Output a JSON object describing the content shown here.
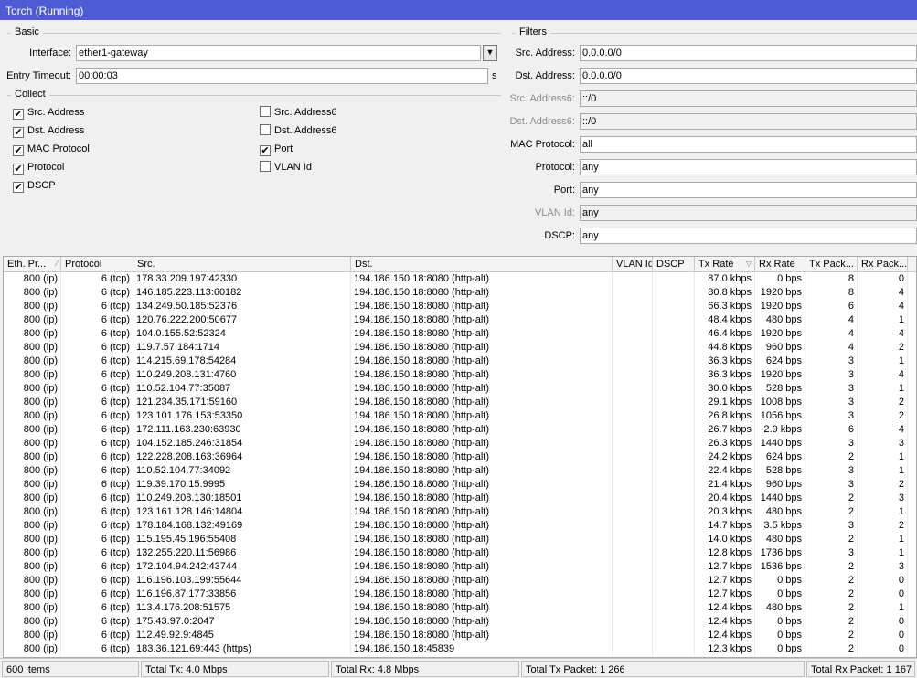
{
  "window": {
    "title": "Torch (Running)"
  },
  "basic": {
    "title": "Basic",
    "interface_label": "Interface:",
    "interface_value": "ether1-gateway",
    "timeout_label": "Entry Timeout:",
    "timeout_value": "00:00:03",
    "timeout_unit": "s"
  },
  "collect": {
    "title": "Collect",
    "items": [
      {
        "label": "Src. Address",
        "checked": true
      },
      {
        "label": "Dst. Address",
        "checked": true
      },
      {
        "label": "MAC Protocol",
        "checked": true
      },
      {
        "label": "Protocol",
        "checked": true
      },
      {
        "label": "DSCP",
        "checked": true
      },
      {
        "label": "Src. Address6",
        "checked": false
      },
      {
        "label": "Dst. Address6",
        "checked": false
      },
      {
        "label": "Port",
        "checked": true
      },
      {
        "label": "VLAN Id",
        "checked": false
      }
    ]
  },
  "filters": {
    "title": "Filters",
    "items": [
      {
        "label": "Src. Address:",
        "value": "0.0.0.0/0",
        "disabled": false
      },
      {
        "label": "Dst. Address:",
        "value": "0.0.0.0/0",
        "disabled": false
      },
      {
        "label": "Src. Address6:",
        "value": "::/0",
        "disabled": true
      },
      {
        "label": "Dst. Address6:",
        "value": "::/0",
        "disabled": true
      },
      {
        "label": "MAC Protocol:",
        "value": "all",
        "disabled": false
      },
      {
        "label": "Protocol:",
        "value": "any",
        "disabled": false
      },
      {
        "label": "Port:",
        "value": "any",
        "disabled": false
      },
      {
        "label": "VLAN Id:",
        "value": "any",
        "disabled": true
      },
      {
        "label": "DSCP:",
        "value": "any",
        "disabled": false
      }
    ]
  },
  "table": {
    "columns": [
      "Eth. Pr...",
      "Protocol",
      "Src.",
      "Dst.",
      "VLAN Id",
      "DSCP",
      "Tx Rate",
      "Rx Rate",
      "Tx Pack...",
      "Rx Pack..."
    ],
    "rows": [
      [
        "800 (ip)",
        "6 (tcp)",
        "178.33.209.197:42330",
        "194.186.150.18:8080 (http-alt)",
        "",
        "",
        "87.0 kbps",
        "0 bps",
        "8",
        "0"
      ],
      [
        "800 (ip)",
        "6 (tcp)",
        "146.185.223.113:60182",
        "194.186.150.18:8080 (http-alt)",
        "",
        "",
        "80.8 kbps",
        "1920 bps",
        "8",
        "4"
      ],
      [
        "800 (ip)",
        "6 (tcp)",
        "134.249.50.185:52376",
        "194.186.150.18:8080 (http-alt)",
        "",
        "",
        "66.3 kbps",
        "1920 bps",
        "6",
        "4"
      ],
      [
        "800 (ip)",
        "6 (tcp)",
        "120.76.222.200:50677",
        "194.186.150.18:8080 (http-alt)",
        "",
        "",
        "48.4 kbps",
        "480 bps",
        "4",
        "1"
      ],
      [
        "800 (ip)",
        "6 (tcp)",
        "104.0.155.52:52324",
        "194.186.150.18:8080 (http-alt)",
        "",
        "",
        "46.4 kbps",
        "1920 bps",
        "4",
        "4"
      ],
      [
        "800 (ip)",
        "6 (tcp)",
        "119.7.57.184:1714",
        "194.186.150.18:8080 (http-alt)",
        "",
        "",
        "44.8 kbps",
        "960 bps",
        "4",
        "2"
      ],
      [
        "800 (ip)",
        "6 (tcp)",
        "114.215.69.178:54284",
        "194.186.150.18:8080 (http-alt)",
        "",
        "",
        "36.3 kbps",
        "624 bps",
        "3",
        "1"
      ],
      [
        "800 (ip)",
        "6 (tcp)",
        "110.249.208.131:4760",
        "194.186.150.18:8080 (http-alt)",
        "",
        "",
        "36.3 kbps",
        "1920 bps",
        "3",
        "4"
      ],
      [
        "800 (ip)",
        "6 (tcp)",
        "110.52.104.77:35087",
        "194.186.150.18:8080 (http-alt)",
        "",
        "",
        "30.0 kbps",
        "528 bps",
        "3",
        "1"
      ],
      [
        "800 (ip)",
        "6 (tcp)",
        "121.234.35.171:59160",
        "194.186.150.18:8080 (http-alt)",
        "",
        "",
        "29.1 kbps",
        "1008 bps",
        "3",
        "2"
      ],
      [
        "800 (ip)",
        "6 (tcp)",
        "123.101.176.153:53350",
        "194.186.150.18:8080 (http-alt)",
        "",
        "",
        "26.8 kbps",
        "1056 bps",
        "3",
        "2"
      ],
      [
        "800 (ip)",
        "6 (tcp)",
        "172.111.163.230:63930",
        "194.186.150.18:8080 (http-alt)",
        "",
        "",
        "26.7 kbps",
        "2.9 kbps",
        "6",
        "4"
      ],
      [
        "800 (ip)",
        "6 (tcp)",
        "104.152.185.246:31854",
        "194.186.150.18:8080 (http-alt)",
        "",
        "",
        "26.3 kbps",
        "1440 bps",
        "3",
        "3"
      ],
      [
        "800 (ip)",
        "6 (tcp)",
        "122.228.208.163:36964",
        "194.186.150.18:8080 (http-alt)",
        "",
        "",
        "24.2 kbps",
        "624 bps",
        "2",
        "1"
      ],
      [
        "800 (ip)",
        "6 (tcp)",
        "110.52.104.77:34092",
        "194.186.150.18:8080 (http-alt)",
        "",
        "",
        "22.4 kbps",
        "528 bps",
        "3",
        "1"
      ],
      [
        "800 (ip)",
        "6 (tcp)",
        "119.39.170.15:9995",
        "194.186.150.18:8080 (http-alt)",
        "",
        "",
        "21.4 kbps",
        "960 bps",
        "3",
        "2"
      ],
      [
        "800 (ip)",
        "6 (tcp)",
        "110.249.208.130:18501",
        "194.186.150.18:8080 (http-alt)",
        "",
        "",
        "20.4 kbps",
        "1440 bps",
        "2",
        "3"
      ],
      [
        "800 (ip)",
        "6 (tcp)",
        "123.161.128.146:14804",
        "194.186.150.18:8080 (http-alt)",
        "",
        "",
        "20.3 kbps",
        "480 bps",
        "2",
        "1"
      ],
      [
        "800 (ip)",
        "6 (tcp)",
        "178.184.168.132:49169",
        "194.186.150.18:8080 (http-alt)",
        "",
        "",
        "14.7 kbps",
        "3.5 kbps",
        "3",
        "2"
      ],
      [
        "800 (ip)",
        "6 (tcp)",
        "115.195.45.196:55408",
        "194.186.150.18:8080 (http-alt)",
        "",
        "",
        "14.0 kbps",
        "480 bps",
        "2",
        "1"
      ],
      [
        "800 (ip)",
        "6 (tcp)",
        "132.255.220.11:56986",
        "194.186.150.18:8080 (http-alt)",
        "",
        "",
        "12.8 kbps",
        "1736 bps",
        "3",
        "1"
      ],
      [
        "800 (ip)",
        "6 (tcp)",
        "172.104.94.242:43744",
        "194.186.150.18:8080 (http-alt)",
        "",
        "",
        "12.7 kbps",
        "1536 bps",
        "2",
        "3"
      ],
      [
        "800 (ip)",
        "6 (tcp)",
        "116.196.103.199:55644",
        "194.186.150.18:8080 (http-alt)",
        "",
        "",
        "12.7 kbps",
        "0 bps",
        "2",
        "0"
      ],
      [
        "800 (ip)",
        "6 (tcp)",
        "116.196.87.177:33856",
        "194.186.150.18:8080 (http-alt)",
        "",
        "",
        "12.7 kbps",
        "0 bps",
        "2",
        "0"
      ],
      [
        "800 (ip)",
        "6 (tcp)",
        "113.4.176.208:51575",
        "194.186.150.18:8080 (http-alt)",
        "",
        "",
        "12.4 kbps",
        "480 bps",
        "2",
        "1"
      ],
      [
        "800 (ip)",
        "6 (tcp)",
        "175.43.97.0:2047",
        "194.186.150.18:8080 (http-alt)",
        "",
        "",
        "12.4 kbps",
        "0 bps",
        "2",
        "0"
      ],
      [
        "800 (ip)",
        "6 (tcp)",
        "112.49.92.9:4845",
        "194.186.150.18:8080 (http-alt)",
        "",
        "",
        "12.4 kbps",
        "0 bps",
        "2",
        "0"
      ],
      [
        "800 (ip)",
        "6 (tcp)",
        "183.36.121.69:443 (https)",
        "194.186.150.18:45839",
        "",
        "",
        "12.3 kbps",
        "0 bps",
        "2",
        "0"
      ]
    ]
  },
  "status": {
    "items": "600 items",
    "total_tx": "Total Tx: 4.0 Mbps",
    "total_rx": "Total Rx: 4.8 Mbps",
    "total_tx_packet": "Total Tx Packet: 1 266",
    "total_rx_packet": "Total Rx Packet: 1 167"
  }
}
